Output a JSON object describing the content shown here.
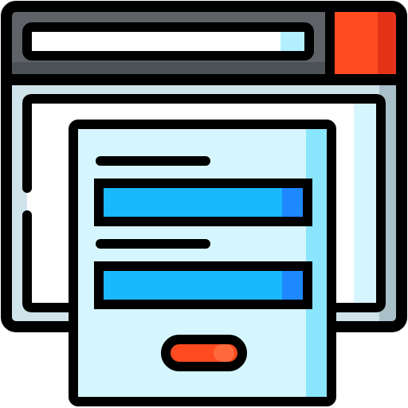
{
  "icon": {
    "name": "web-form-icon",
    "colors": {
      "outline": "#000000",
      "titlebar": "#5F6368",
      "titlebar_shade": "#4D5256",
      "address_bar": "#FFFFFF",
      "address_bar_shade": "#B3F0FF",
      "close_button": "#FF4B1F",
      "close_button_shade": "#E5331A",
      "window_body": "#CFE3EA",
      "window_body_shade": "#A9C0C9",
      "content_area": "#FFFFFF",
      "content_area_shade": "#D6F6FF",
      "form_panel": "#D6F6FF",
      "form_panel_shade": "#8AE6FF",
      "input_field": "#1AB8FF",
      "input_field_shade": "#1E88FF",
      "submit_button": "#FF4B1F",
      "submit_button_highlight": "#FF6A3D"
    }
  }
}
